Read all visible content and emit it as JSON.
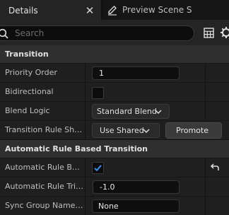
{
  "tabs": [
    {
      "label": "Details",
      "icon": "details-tab-icon"
    },
    {
      "label": "Preview Scene S",
      "icon": "pencil-icon"
    }
  ],
  "tab_close_glyph": "✕",
  "search": {
    "placeholder": "Search"
  },
  "categories": [
    {
      "label": "Transition"
    },
    {
      "label": "Automatic Rule Based Transition"
    }
  ],
  "properties": {
    "priority_order": {
      "label": "Priority Order",
      "value": "1"
    },
    "bidirectional": {
      "label": "Bidirectional",
      "checked": false
    },
    "blend_logic": {
      "label": "Blend Logic",
      "value": "Standard Blend"
    },
    "transition_rule_sharing": {
      "label": "Transition Rule Sharir",
      "value": "Use Shared",
      "button": "Promote"
    },
    "automatic_rule_based": {
      "label": "Automatic Rule Bas...",
      "checked": true
    },
    "automatic_rule_trigger": {
      "label": "Automatic Rule Trig...",
      "value": "-1.0"
    },
    "sync_group_name": {
      "label": "Sync Group Name t...",
      "value": "None"
    }
  },
  "colors": {
    "accent": "#3b8eea",
    "panel_bg": "#1c1c1c",
    "category_bg": "#2f2f2f"
  }
}
